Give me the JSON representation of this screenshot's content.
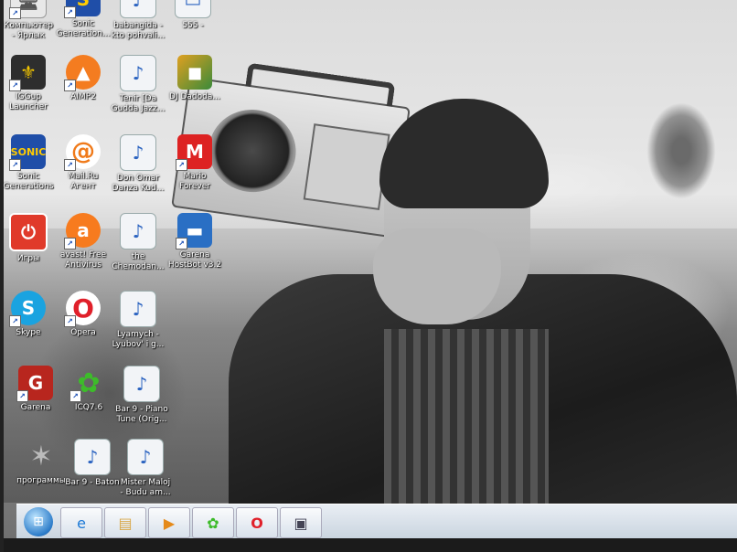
{
  "desktop_icons": [
    {
      "label": "Компьютер\n- Ярлык",
      "icon": "computer-icon"
    },
    {
      "label": "Sonic\nGeneration...",
      "icon": "sonic-icon"
    },
    {
      "label": "babangida -\nkto pohvali...",
      "icon": "audio-file-icon"
    },
    {
      "label": "555 -",
      "icon": "file-icon"
    },
    {
      "label": "IGGup\nLauncher",
      "icon": "iggup-icon"
    },
    {
      "label": "AIMP2",
      "icon": "aimp-icon"
    },
    {
      "label": "Tenir [Da\nGudda Jazz...",
      "icon": "audio-file-icon"
    },
    {
      "label": "DJ Dadoda...",
      "icon": "image-file-icon"
    },
    {
      "label": "Sonic\nGenerations",
      "icon": "sonic-icon"
    },
    {
      "label": "Mail.Ru\nАгент",
      "icon": "mailru-agent-icon"
    },
    {
      "label": "Don Omar\nDanza Kud...",
      "icon": "audio-file-icon"
    },
    {
      "label": "Mario\nForever",
      "icon": "mario-icon"
    },
    {
      "label": "Игры",
      "icon": "games-icon"
    },
    {
      "label": "avast! Free\nAntivirus",
      "icon": "avast-icon"
    },
    {
      "label": "the\nChemodan...",
      "icon": "audio-file-icon"
    },
    {
      "label": "Garena\nHostBot v3.2",
      "icon": "garena-hostbot-icon"
    },
    {
      "label": "Skype",
      "icon": "skype-icon"
    },
    {
      "label": "Opera",
      "icon": "opera-icon"
    },
    {
      "label": "Lyamych -\nLyubov' i g...",
      "icon": "audio-file-icon"
    },
    {
      "label": "Garena",
      "icon": "garena-icon"
    },
    {
      "label": "ICQ7.6",
      "icon": "icq-icon"
    },
    {
      "label": "Bar 9 - Piano\nTune (Orig...",
      "icon": "audio-file-icon"
    },
    {
      "label": "программы",
      "icon": "programs-icon"
    },
    {
      "label": "Bar 9 - Baton",
      "icon": "audio-file-icon"
    },
    {
      "label": "Mister Maloj\n- Budu am...",
      "icon": "audio-file-icon"
    }
  ],
  "taskbar": {
    "start": "windows-start-icon",
    "pinned": [
      "ie-icon",
      "explorer-icon",
      "media-player-icon",
      "icq-icon",
      "opera-icon",
      "game-icon"
    ]
  }
}
